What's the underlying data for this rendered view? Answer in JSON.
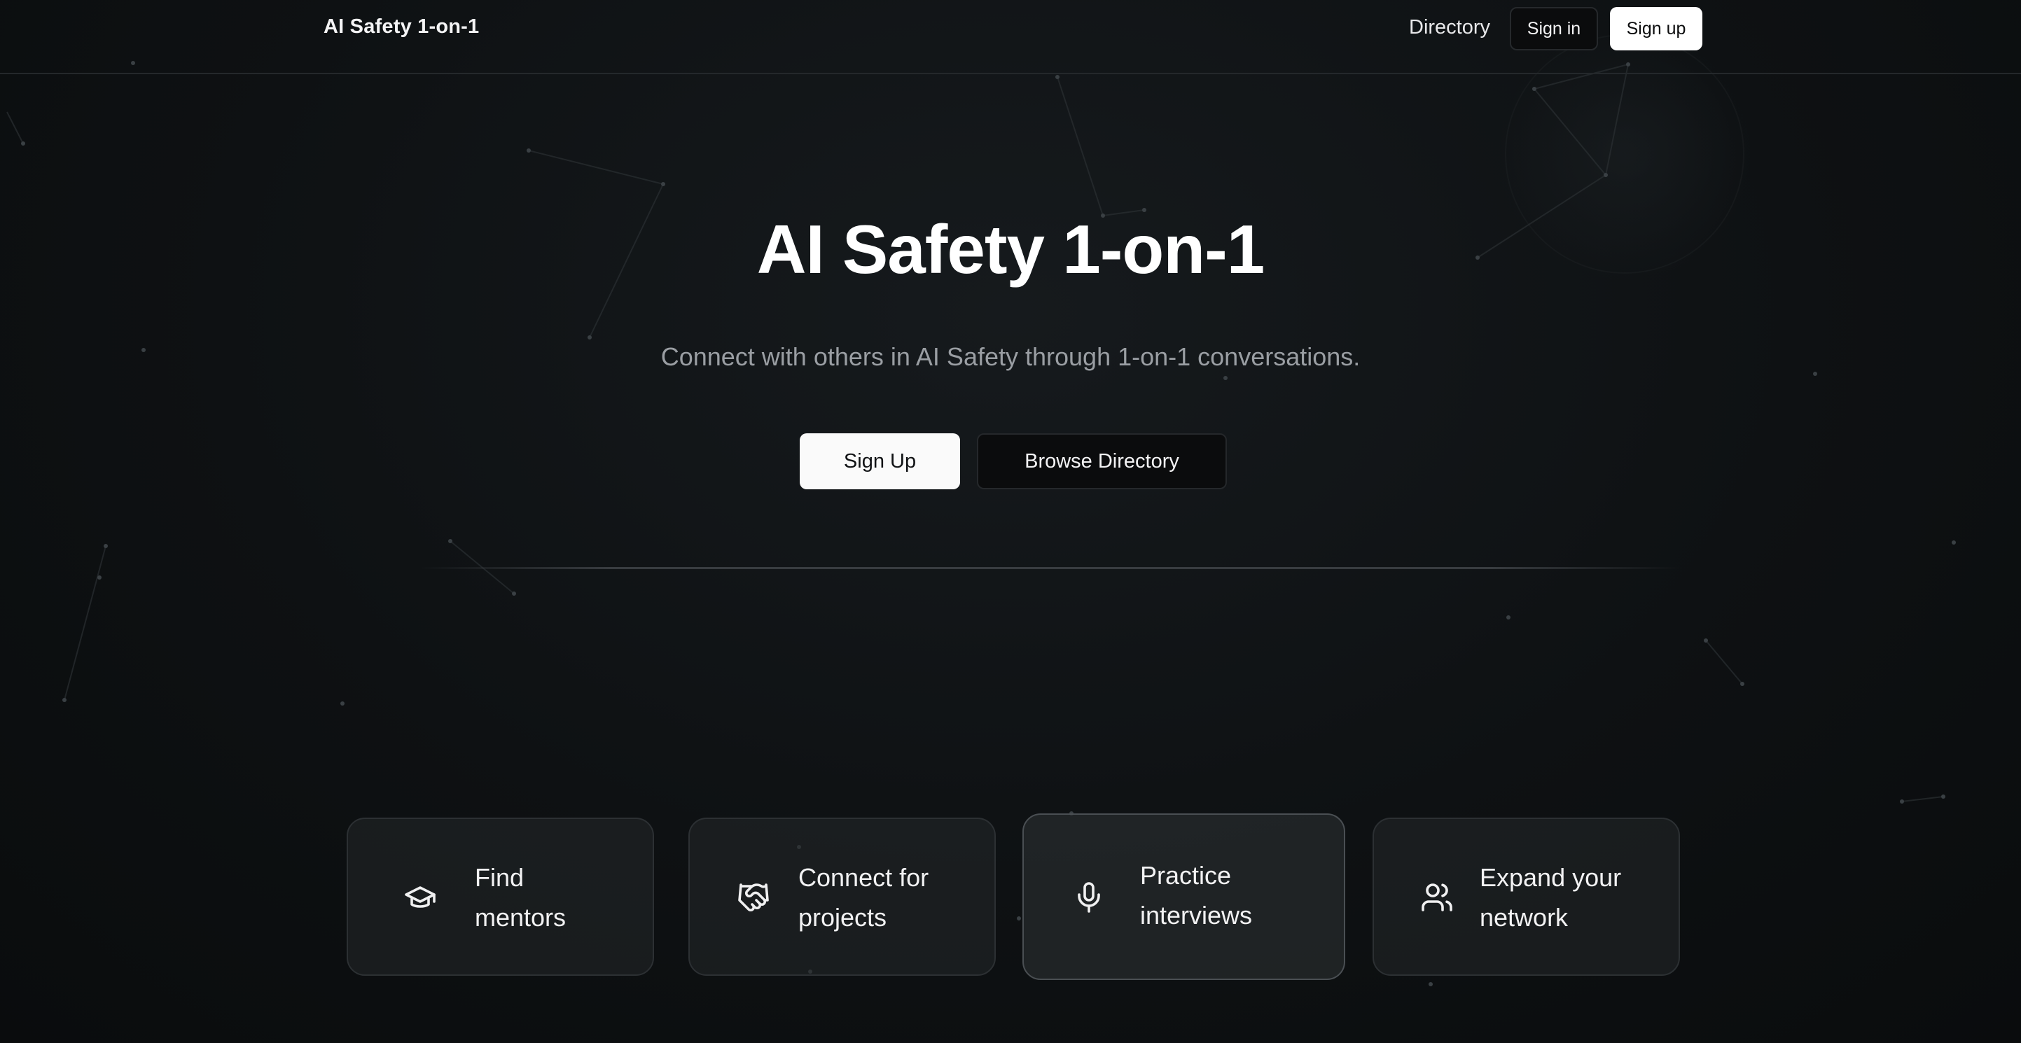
{
  "nav": {
    "brand": "AI Safety 1-on-1",
    "directory_link": "Directory",
    "sign_in": "Sign in",
    "sign_up": "Sign up"
  },
  "hero": {
    "title": "AI Safety 1-on-1",
    "subtitle": "Connect with others in AI Safety through 1-on-1 conversations.",
    "primary_cta": "Sign Up",
    "secondary_cta": "Browse Directory"
  },
  "features": [
    {
      "icon": "graduation-cap-icon",
      "line1": "Find",
      "line2": "mentors"
    },
    {
      "icon": "handshake-icon",
      "line1": "Connect for",
      "line2": "projects"
    },
    {
      "icon": "microphone-icon",
      "line1": "Practice",
      "line2": "interviews"
    },
    {
      "icon": "users-icon",
      "line1": "Expand your",
      "line2": "network"
    }
  ]
}
